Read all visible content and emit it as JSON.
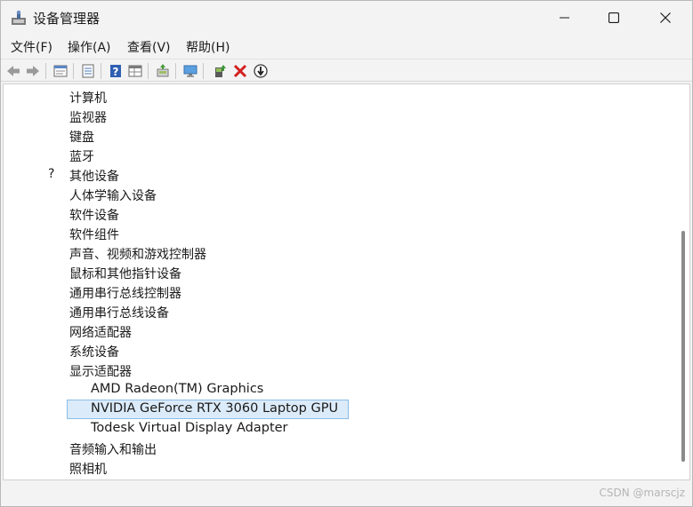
{
  "window": {
    "title": "设备管理器"
  },
  "menu": [
    "文件(F)",
    "操作(A)",
    "查看(V)",
    "帮助(H)"
  ],
  "toolbar": [
    "back-icon",
    "forward-icon",
    "sep",
    "properties-icon",
    "sep",
    "list-icon",
    "sep",
    "help-icon",
    "grid-view-icon",
    "sep",
    "scan-icon",
    "sep",
    "monitor-icon",
    "sep",
    "update-driver-icon",
    "uninstall-icon",
    "download-icon"
  ],
  "tree": [
    {
      "label": "计算机",
      "icon": "computer-icon",
      "level": 0,
      "expanded": false
    },
    {
      "label": "监视器",
      "icon": "monitor-icon",
      "level": 0,
      "expanded": false
    },
    {
      "label": "键盘",
      "icon": "keyboard-icon",
      "level": 0,
      "expanded": false
    },
    {
      "label": "蓝牙",
      "icon": "bluetooth-icon",
      "level": 0,
      "expanded": false
    },
    {
      "label": "其他设备",
      "icon": "other-device-icon",
      "level": 0,
      "expanded": false
    },
    {
      "label": "人体学输入设备",
      "icon": "hid-icon",
      "level": 0,
      "expanded": false
    },
    {
      "label": "软件设备",
      "icon": "software-device-icon",
      "level": 0,
      "expanded": false
    },
    {
      "label": "软件组件",
      "icon": "software-component-icon",
      "level": 0,
      "expanded": false
    },
    {
      "label": "声音、视频和游戏控制器",
      "icon": "speaker-icon",
      "level": 0,
      "expanded": false
    },
    {
      "label": "鼠标和其他指针设备",
      "icon": "mouse-icon",
      "level": 0,
      "expanded": false
    },
    {
      "label": "通用串行总线控制器",
      "icon": "usb-icon",
      "level": 0,
      "expanded": false
    },
    {
      "label": "通用串行总线设备",
      "icon": "usb-icon",
      "level": 0,
      "expanded": false
    },
    {
      "label": "网络适配器",
      "icon": "network-icon",
      "level": 0,
      "expanded": false
    },
    {
      "label": "系统设备",
      "icon": "system-icon",
      "level": 0,
      "expanded": false
    },
    {
      "label": "显示适配器",
      "icon": "display-adapter-icon",
      "level": 0,
      "expanded": true
    },
    {
      "label": "AMD Radeon(TM) Graphics",
      "icon": "display-adapter-icon",
      "level": 1
    },
    {
      "label": "NVIDIA GeForce RTX 3060 Laptop GPU",
      "icon": "display-adapter-icon",
      "level": 1,
      "selected": true
    },
    {
      "label": "Todesk Virtual Display Adapter",
      "icon": "display-adapter-icon",
      "level": 1
    },
    {
      "label": "音频输入和输出",
      "icon": "audio-icon",
      "level": 0,
      "expanded": false
    },
    {
      "label": "照相机",
      "icon": "camera-icon",
      "level": 0,
      "expanded": false
    }
  ],
  "watermark": "CSDN @marscjz"
}
